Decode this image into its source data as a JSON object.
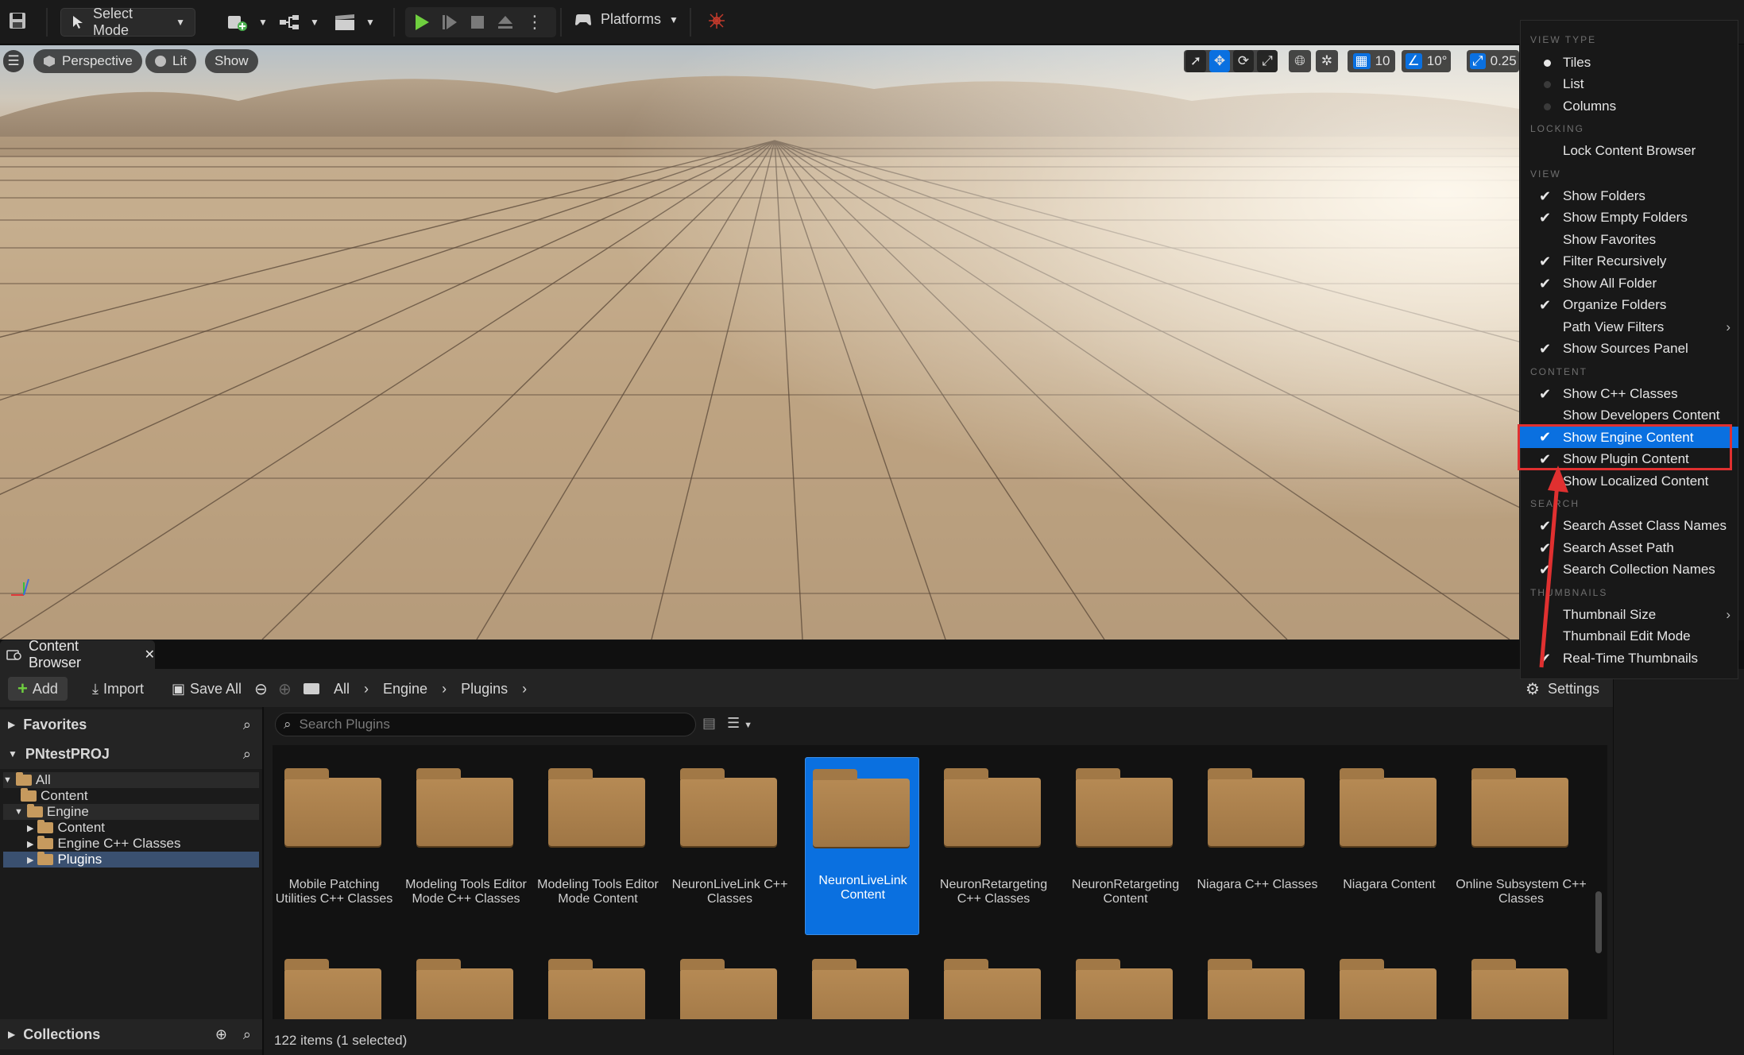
{
  "toolbar": {
    "mode_label": "Select Mode",
    "platforms_label": "Platforms"
  },
  "viewport": {
    "perspective_label": "Perspective",
    "lit_label": "Lit",
    "show_label": "Show",
    "grid_snap_value": "10",
    "rotation_snap_value": "10°",
    "scale_snap_value": "0.25"
  },
  "content_browser": {
    "tab_label": "Content Browser",
    "add_label": "Add",
    "import_label": "Import",
    "save_all_label": "Save All",
    "breadcrumb": [
      "All",
      "Engine",
      "Plugins"
    ],
    "settings_label": "Settings",
    "search_placeholder": "Search Plugins",
    "status_text": "122 items (1 selected)"
  },
  "sources": {
    "favorites_label": "Favorites",
    "project_label": "PNtestPROJ",
    "collections_label": "Collections",
    "tree": [
      "All",
      "Content",
      "Engine",
      "Content",
      "Engine C++ Classes",
      "Plugins"
    ]
  },
  "assets": [
    {
      "name": "Mobile Patching Utilities C++ Classes",
      "selected": false
    },
    {
      "name": "Modeling Tools Editor Mode C++ Classes",
      "selected": false
    },
    {
      "name": "Modeling Tools Editor Mode Content",
      "selected": false
    },
    {
      "name": "NeuronLiveLink C++ Classes",
      "selected": false
    },
    {
      "name": "NeuronLiveLink Content",
      "selected": true
    },
    {
      "name": "NeuronRetargeting C++ Classes",
      "selected": false
    },
    {
      "name": "NeuronRetargeting Content",
      "selected": false
    },
    {
      "name": "Niagara C++ Classes",
      "selected": false
    },
    {
      "name": "Niagara Content",
      "selected": false
    },
    {
      "name": "Online Subsystem C++ Classes",
      "selected": false
    }
  ],
  "menu": {
    "headers": {
      "view_type": "VIEW TYPE",
      "locking": "LOCKING",
      "view": "VIEW",
      "content": "CONTENT",
      "search": "SEARCH",
      "thumbnails": "THUMBNAILS"
    },
    "view_type": [
      "Tiles",
      "List",
      "Columns"
    ],
    "locking": [
      "Lock Content Browser"
    ],
    "view": [
      {
        "label": "Show Folders",
        "checked": true
      },
      {
        "label": "Show Empty Folders",
        "checked": true
      },
      {
        "label": "Show Favorites",
        "checked": false
      },
      {
        "label": "Filter Recursively",
        "checked": true
      },
      {
        "label": "Show All Folder",
        "checked": true
      },
      {
        "label": "Organize Folders",
        "checked": true
      },
      {
        "label": "Path View Filters",
        "checked": false,
        "submenu": true
      },
      {
        "label": "Show Sources Panel",
        "checked": true
      }
    ],
    "content": [
      {
        "label": "Show C++ Classes",
        "checked": true
      },
      {
        "label": "Show Developers Content",
        "checked": false
      },
      {
        "label": "Show Engine Content",
        "checked": true,
        "highlighted": true
      },
      {
        "label": "Show Plugin Content",
        "checked": true
      },
      {
        "label": "Show Localized Content",
        "checked": false
      }
    ],
    "search": [
      {
        "label": "Search Asset Class Names",
        "checked": true
      },
      {
        "label": "Search Asset Path",
        "checked": true
      },
      {
        "label": "Search Collection Names",
        "checked": true
      }
    ],
    "thumbnails": [
      {
        "label": "Thumbnail Size",
        "checked": false,
        "submenu": true
      },
      {
        "label": "Thumbnail Edit Mode",
        "checked": false
      },
      {
        "label": "Real-Time Thumbnails",
        "checked": true
      }
    ]
  }
}
